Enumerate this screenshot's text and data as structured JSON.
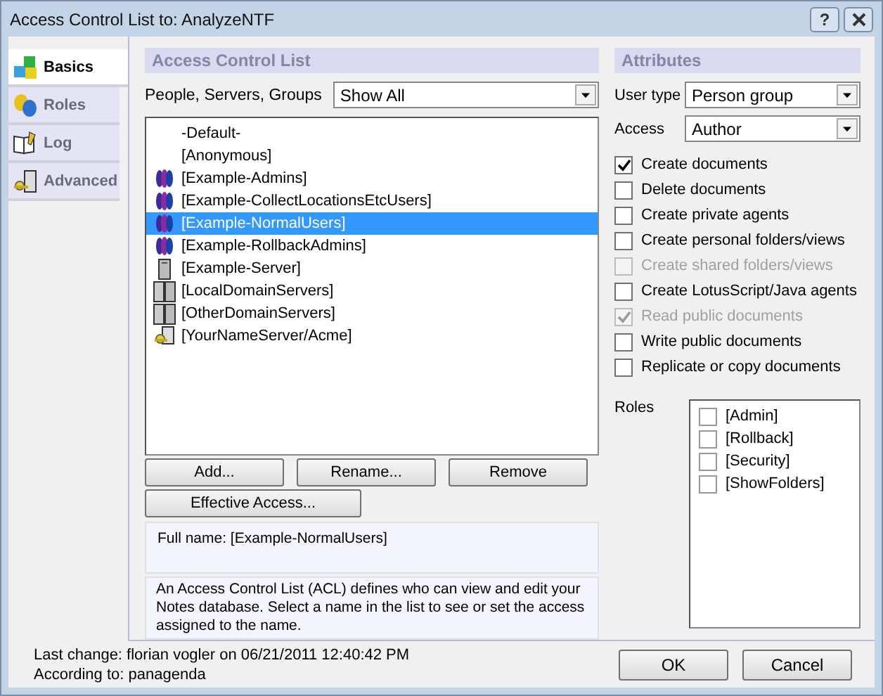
{
  "window": {
    "title": "Access Control List to: AnalyzeNTF",
    "help": "?"
  },
  "tabs": [
    {
      "label": "Basics",
      "kind": "blocks",
      "selected": true
    },
    {
      "label": "Roles",
      "kind": "masks",
      "selected": false
    },
    {
      "label": "Log",
      "kind": "book",
      "selected": false
    },
    {
      "label": "Advanced",
      "kind": "keyserver",
      "selected": false
    }
  ],
  "acl": {
    "title": "Access Control List",
    "filter_label": "People, Servers, Groups",
    "filter_value": "Show All",
    "entries": [
      {
        "name": "-Default-",
        "kind": "none",
        "selected": false
      },
      {
        "name": "[Anonymous]",
        "kind": "none",
        "selected": false
      },
      {
        "name": "[Example-Admins]",
        "kind": "group",
        "selected": false
      },
      {
        "name": "[Example-CollectLocationsEtcUsers]",
        "kind": "group",
        "selected": false
      },
      {
        "name": "[Example-NormalUsers]",
        "kind": "group",
        "selected": true
      },
      {
        "name": "[Example-RollbackAdmins]",
        "kind": "group",
        "selected": false
      },
      {
        "name": "[Example-Server]",
        "kind": "server",
        "selected": false
      },
      {
        "name": "[LocalDomainServers]",
        "kind": "servers",
        "selected": false
      },
      {
        "name": "[OtherDomainServers]",
        "kind": "servers",
        "selected": false
      },
      {
        "name": "[YourNameServer/Acme]",
        "kind": "keyserver",
        "selected": false
      }
    ],
    "buttons": [
      "Add...",
      "Rename...",
      "Remove"
    ],
    "effective_access": "Effective Access...",
    "full_name": "Full name: [Example-NormalUsers]",
    "description": "An Access Control List (ACL) defines who can view and edit your Notes database.  Select a name in the list to see or set the access assigned to the name."
  },
  "attributes": {
    "title": "Attributes",
    "user_type": {
      "label": "User type",
      "value": "Person group"
    },
    "access": {
      "label": "Access",
      "value": "Author"
    },
    "options": [
      {
        "label": "Create documents",
        "checked": true,
        "disabled": false
      },
      {
        "label": "Delete documents",
        "checked": false,
        "disabled": false
      },
      {
        "label": "Create private agents",
        "checked": false,
        "disabled": false
      },
      {
        "label": "Create personal folders/views",
        "checked": false,
        "disabled": false
      },
      {
        "label": "Create shared folders/views",
        "checked": false,
        "disabled": true
      },
      {
        "label": "Create LotusScript/Java agents",
        "checked": false,
        "disabled": false
      },
      {
        "label": "Read public documents",
        "checked": true,
        "disabled": true
      },
      {
        "label": "Write public documents",
        "checked": false,
        "disabled": false
      },
      {
        "label": "Replicate or copy documents",
        "checked": false,
        "disabled": false
      }
    ],
    "roles_label": "Roles",
    "roles": [
      {
        "label": "[Admin]",
        "checked": false
      },
      {
        "label": "[Rollback]",
        "checked": false
      },
      {
        "label": "[Security]",
        "checked": false
      },
      {
        "label": "[ShowFolders]",
        "checked": false
      }
    ]
  },
  "footer": {
    "last_change": "Last change: florian vogler on 06/21/2011 12:40:42 PM",
    "according_to": "According to: panagenda"
  },
  "buttons": [
    "OK",
    "Cancel"
  ]
}
